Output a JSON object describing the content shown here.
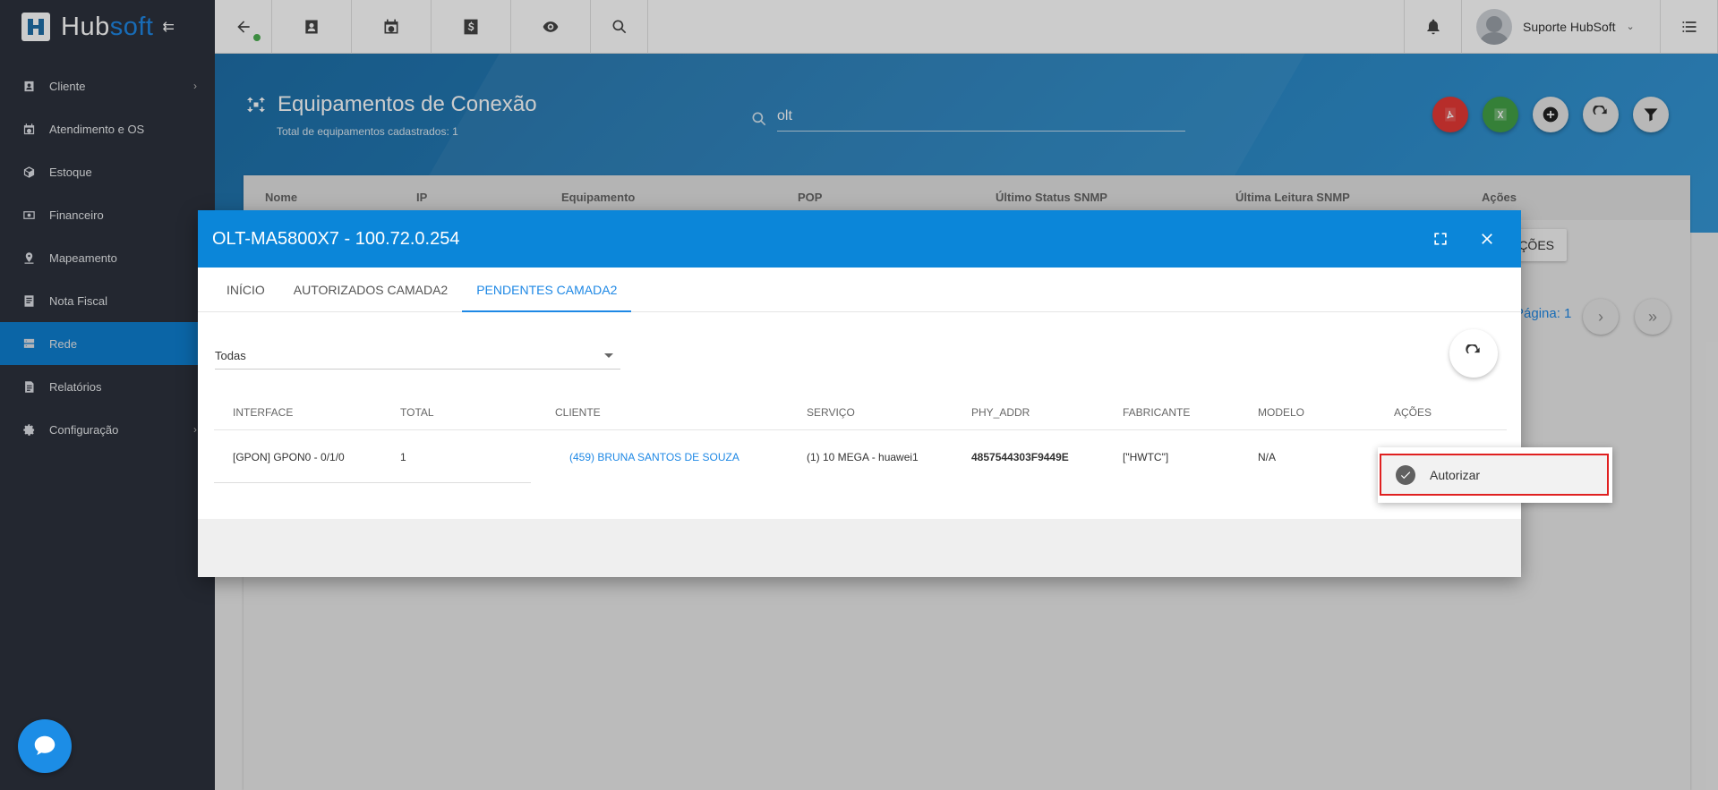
{
  "brand": {
    "name_part1": "Hub",
    "name_part2": "soft"
  },
  "sidebar": {
    "items": [
      {
        "label": "Cliente",
        "icon": "contact-card-icon"
      },
      {
        "label": "Atendimento e OS",
        "icon": "calendar-clock-icon"
      },
      {
        "label": "Estoque",
        "icon": "box-icon"
      },
      {
        "label": "Financeiro",
        "icon": "money-icon"
      },
      {
        "label": "Mapeamento",
        "icon": "map-pin-icon"
      },
      {
        "label": "Nota Fiscal",
        "icon": "document-icon"
      },
      {
        "label": "Rede",
        "icon": "server-icon"
      },
      {
        "label": "Relatórios",
        "icon": "report-icon"
      },
      {
        "label": "Configuração",
        "icon": "gear-icon"
      }
    ],
    "active": "Rede"
  },
  "topbar": {
    "user_name": "Suporte HubSoft"
  },
  "page": {
    "title": "Equipamentos de Conexão",
    "subtitle": "Total de equipamentos cadastrados: 1",
    "search_value": "olt"
  },
  "bg_table": {
    "headers": [
      "Nome",
      "IP",
      "Equipamento",
      "POP",
      "Último Status SNMP",
      "Última Leitura SNMP",
      "Ações"
    ],
    "acoes_btn": "ÇÕES",
    "pagination": "Página: 1"
  },
  "colors": {
    "accent": "#0b86d9",
    "pdf": "#e53935",
    "excel": "#43a047",
    "highlight": "#e02020"
  },
  "modal": {
    "title": "OLT-MA5800X7 - 100.72.0.254",
    "tabs": [
      "INÍCIO",
      "AUTORIZADOS CAMADA2",
      "PENDENTES CAMADA2"
    ],
    "active_tab": "PENDENTES CAMADA2",
    "filter_value": "Todas",
    "columns": [
      "INTERFACE",
      "TOTAL",
      "CLIENTE",
      "SERVIÇO",
      "PHY_ADDR",
      "FABRICANTE",
      "MODELO",
      "AÇÕES"
    ],
    "rows": [
      {
        "interface": "[GPON] GPON0 - 0/1/0",
        "total": "1",
        "cliente": "(459) BRUNA SANTOS DE SOUZA",
        "servico": "(1) 10 MEGA - huawei1",
        "phy_addr": "4857544303F9449E",
        "fabricante": "[\"HWTC\"]",
        "modelo": "N/A"
      }
    ]
  },
  "menu": {
    "item_label": "Autorizar"
  }
}
